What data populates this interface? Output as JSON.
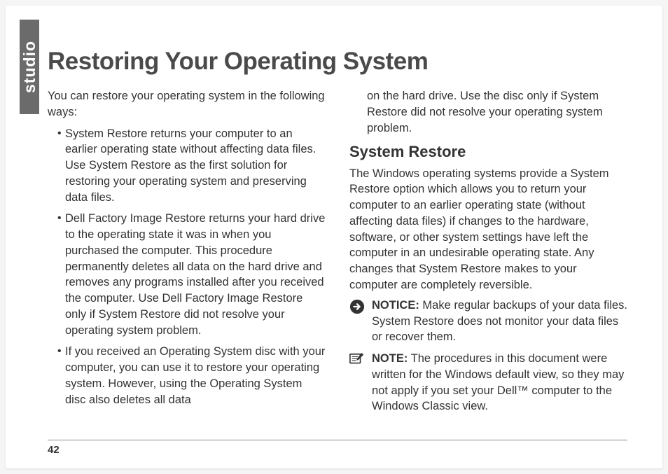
{
  "sideTab": "studio",
  "title": "Restoring Your Operating System",
  "leftColumn": {
    "intro": "You can restore your operating system in the following ways:",
    "bullets": [
      "System Restore returns your computer to an earlier operating state without affecting data files. Use System Restore as the first solution for restoring your operating system and preserving data files.",
      "Dell Factory Image Restore returns your hard drive to the operating state it was in when you purchased the computer. This procedure permanently deletes all data on the hard drive and removes any programs installed after you received the computer. Use Dell Factory Image Restore only if System Restore did not resolve your operating system problem.",
      "If you received an Operating System disc with your computer, you can use it to restore your operating system. However, using the Operating System disc also deletes all data"
    ]
  },
  "rightColumn": {
    "continuation": "on the hard drive. Use the disc only if System Restore did not resolve your operating system problem.",
    "subheading": "System Restore",
    "para": "The Windows operating systems provide a System Restore option which allows you to return your computer to an earlier operating state (without affecting data files) if changes to the hardware, software, or other system settings have left the computer in an undesirable operating state. Any changes that System Restore makes to your computer are completely reversible.",
    "noticeLabel": "NOTICE:",
    "noticeText": " Make regular backups of your data files. System Restore does not monitor your data files or recover them.",
    "noteLabel": "NOTE:",
    "noteText": " The procedures in this document were written for the Windows default view, so they may not apply if you set your Dell™ computer to the Windows Classic view."
  },
  "pageNumber": "42"
}
